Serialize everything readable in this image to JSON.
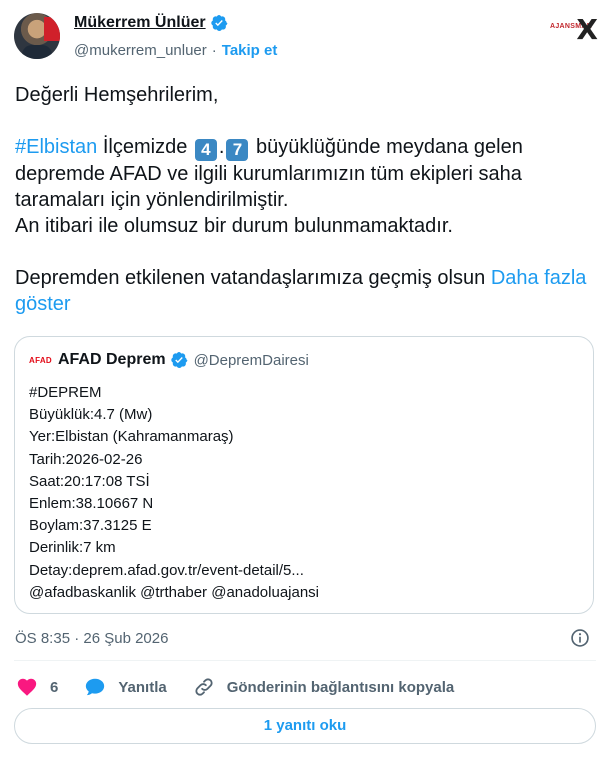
{
  "author": {
    "name": "Mükerrem Ünlüer",
    "handle": "@mukerrem_unluer",
    "separator": "·",
    "follow_label": "Takip et"
  },
  "brand": {
    "logo_text": "AJANSMAN",
    "x_glyph": "X"
  },
  "tweet": {
    "line1": "Değerli Hemşehrilerim,",
    "hashtag": "#Elbistan",
    "text_a": " İlçemizde ",
    "digit1": "4",
    "dot": ".",
    "digit2": "7",
    "text_b": " büyüklüğünde meydana gelen depremde AFAD ve ilgili kurumlarımızın tüm ekipleri saha taramaları için yönlendirilmiştir.",
    "line3": "An itibari ile olumsuz bir durum bulunmamaktadır.",
    "line4": "Depremden etkilenen vatandaşlarımıza geçmiş olsun ",
    "more_label": "Daha fazla göster"
  },
  "quoted": {
    "logo": "AFAD",
    "name": "AFAD Deprem",
    "handle": "@DepremDairesi",
    "lines": [
      "#DEPREM",
      "Büyüklük:4.7 (Mw)",
      "Yer:Elbistan (Kahramanmaraş)",
      "Tarih:2026-02-26",
      "Saat:20:17:08 TSİ",
      "Enlem:38.10667 N",
      "Boylam:37.3125 E",
      "Derinlik:7 km",
      "Detay:deprem.afad.gov.tr/event-detail/5...",
      "@afadbaskanlik @trthaber @anadoluajansi"
    ]
  },
  "timestamp": "ÖS 8:35 · 26 Şub 2026",
  "actions": {
    "like_count": "6",
    "reply_label": "Yanıtla",
    "copy_label": "Gönderinin bağlantısını kopyala"
  },
  "read_replies_label": "1 yanıtı oku",
  "colors": {
    "accent": "#1d9bf0",
    "like": "#f91880",
    "keycap": "#3b88c3"
  }
}
